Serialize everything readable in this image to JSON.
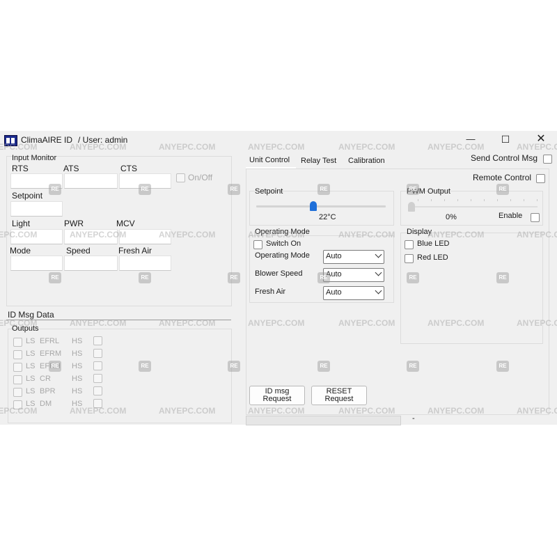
{
  "window": {
    "app_title": "ClimaAIRE ID",
    "user_label": "/ User: admin",
    "minimize_glyph": "—",
    "maximize_glyph": "☐",
    "close_glyph": "✕"
  },
  "input_monitor": {
    "title": "Input Monitor",
    "rts": "RTS",
    "ats": "ATS",
    "cts": "CTS",
    "on_off": "On/Off",
    "setpoint": "Setpoint",
    "light": "Light",
    "pwr": "PWR",
    "mcv": "MCV",
    "mode": "Mode",
    "speed": "Speed",
    "fresh_air": "Fresh Air"
  },
  "id_msg": {
    "title": "ID Msg Data",
    "outputs_title": "Outputs",
    "rows": [
      {
        "ls": "LS",
        "name": "EFRL",
        "hs": "HS"
      },
      {
        "ls": "LS",
        "name": "EFRM",
        "hs": "HS"
      },
      {
        "ls": "LS",
        "name": "EFRH",
        "hs": "HS"
      },
      {
        "ls": "LS",
        "name": "CR",
        "hs": "HS"
      },
      {
        "ls": "LS",
        "name": "BPR",
        "hs": "HS"
      },
      {
        "ls": "LS",
        "name": "DM",
        "hs": "HS"
      }
    ]
  },
  "tabs": [
    "Unit Control",
    "Relay Test",
    "Calibration"
  ],
  "send_control_msg": "Send Control Msg",
  "remote_control": "Remote Control",
  "setpoint": {
    "title": "Setpoint",
    "value_text": "22°C",
    "level_fraction": 0.44
  },
  "pwm": {
    "title": "PWM Output",
    "value_text": "0%",
    "enable": "Enable"
  },
  "operating_mode": {
    "title": "Operating Mode",
    "switch_on": "Switch On",
    "rows": [
      {
        "label": "Operating Mode",
        "value": "Auto"
      },
      {
        "label": "Blower Speed",
        "value": "Auto"
      },
      {
        "label": "Fresh Air",
        "value": "Auto"
      }
    ]
  },
  "display": {
    "title": "Display",
    "blue_led": "Blue LED",
    "red_led": "Red LED"
  },
  "buttons": {
    "id_msg": "ID msg Request",
    "reset": "RESET Request"
  },
  "status_dash": "-",
  "watermark": {
    "text": "ANYEPC.COM",
    "logo": "RE"
  },
  "colors": {
    "accent": "#1e6fd9",
    "window_bg": "#f0f0f0"
  }
}
